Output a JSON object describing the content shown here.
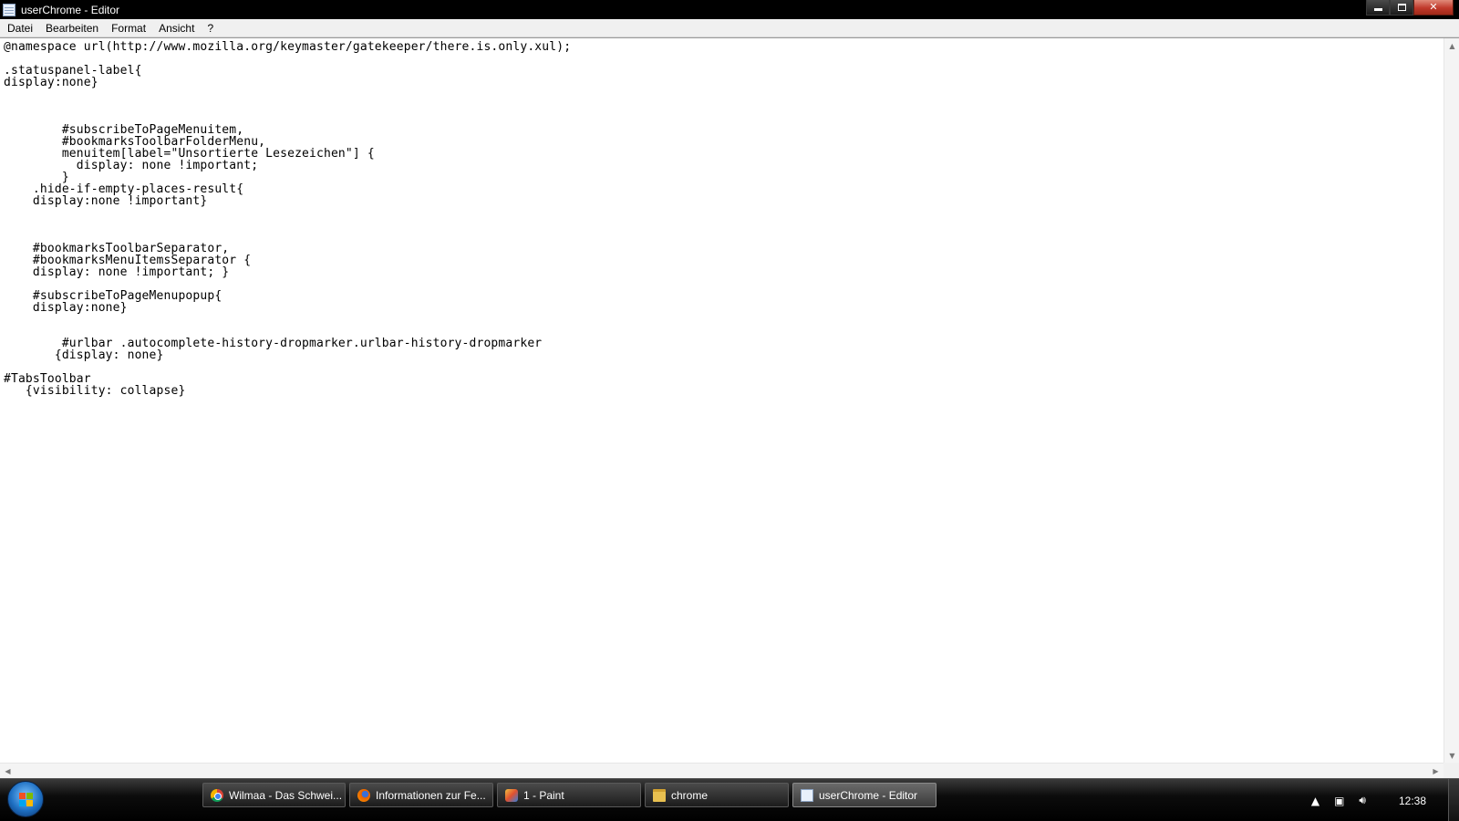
{
  "window": {
    "title": "userChrome - Editor"
  },
  "menu": {
    "items": [
      "Datei",
      "Bearbeiten",
      "Format",
      "Ansicht",
      "?"
    ]
  },
  "editor": {
    "lines": [
      "@namespace url(http://www.mozilla.org/keymaster/gatekeeper/there.is.only.xul);",
      "",
      ".statuspanel-label{",
      "display:none}",
      "",
      "",
      "",
      "        #subscribeToPageMenuitem,",
      "        #bookmarksToolbarFolderMenu,",
      "        menuitem[label=\"Unsortierte Lesezeichen\"] {",
      "          display: none !important;",
      "        }",
      "    .hide-if-empty-places-result{",
      "    display:none !important}",
      "",
      "",
      "",
      "    #bookmarksToolbarSeparator,",
      "    #bookmarksMenuItemsSeparator {",
      "    display: none !important; }",
      "",
      "    #subscribeToPageMenupopup{",
      "    display:none}",
      "",
      "",
      "        #urlbar .autocomplete-history-dropmarker.urlbar-history-dropmarker",
      "       {display: none}",
      "",
      "#TabsToolbar",
      "   {visibility: collapse}"
    ]
  },
  "taskbar": {
    "buttons": [
      {
        "label": "Wilmaa - Das Schwei...",
        "icon": "chrome-icon"
      },
      {
        "label": "Informationen zur Fe...",
        "icon": "firefox-icon"
      },
      {
        "label": "1 - Paint",
        "icon": "paint-icon"
      },
      {
        "label": "chrome",
        "icon": "folder-icon"
      },
      {
        "label": "userChrome - Editor",
        "icon": "notepad-icon"
      }
    ],
    "clock": "12:38"
  }
}
